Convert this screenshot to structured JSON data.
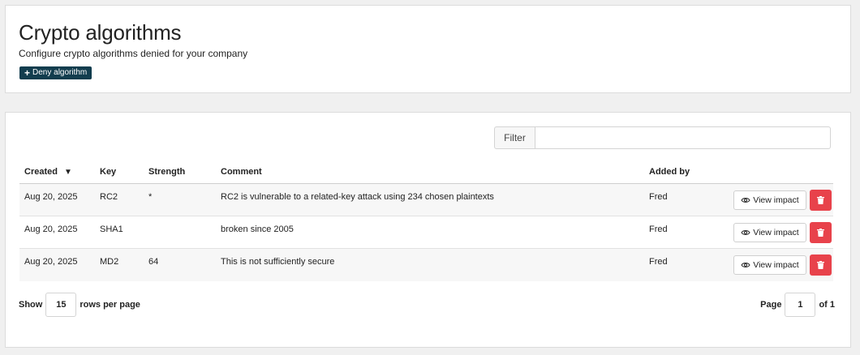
{
  "header": {
    "title": "Crypto algorithms",
    "subtitle": "Configure crypto algorithms denied for your company",
    "deny_button_label": "Deny algorithm",
    "deny_button_color": "#123d4e"
  },
  "filter": {
    "label": "Filter",
    "value": ""
  },
  "table": {
    "columns": [
      "Created",
      "Key",
      "Strength",
      "Comment",
      "Added by"
    ],
    "sort_column": "Created",
    "sort_direction": "descending",
    "rows": [
      {
        "created": "Aug 20, 2025",
        "key": "RC2",
        "strength": "*",
        "comment": "RC2 is vulnerable to a related-key attack using 234 chosen plaintexts",
        "added_by": "Fred"
      },
      {
        "created": "Aug 20, 2025",
        "key": "SHA1",
        "strength": "",
        "comment": "broken since 2005",
        "added_by": "Fred"
      },
      {
        "created": "Aug 20, 2025",
        "key": "MD2",
        "strength": "64",
        "comment": "This is not sufficiently secure",
        "added_by": "Fred"
      }
    ],
    "view_impact_label": "View impact",
    "delete_button_color": "#e8424b"
  },
  "pagination": {
    "show_label": "Show",
    "rows_per_page": "15",
    "rows_per_page_label": "rows per page",
    "page_label": "Page",
    "current_page": "1",
    "of_label": "of 1"
  }
}
